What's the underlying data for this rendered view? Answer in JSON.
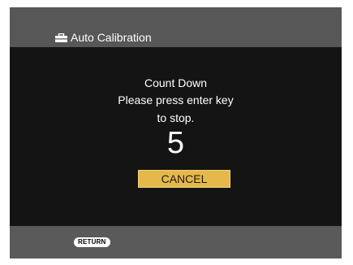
{
  "header": {
    "icon": "toolbox-icon",
    "title": "Auto Calibration"
  },
  "dialog": {
    "line1": "Count Down",
    "line2": "Please press enter key",
    "line3": "to stop.",
    "countdown": "5",
    "cancel_label": "CANCEL"
  },
  "footer": {
    "return_label": "RETURN"
  },
  "colors": {
    "panel": "#141414",
    "frame": "#5a5a5a",
    "cancel_button": "#e6b84a"
  }
}
